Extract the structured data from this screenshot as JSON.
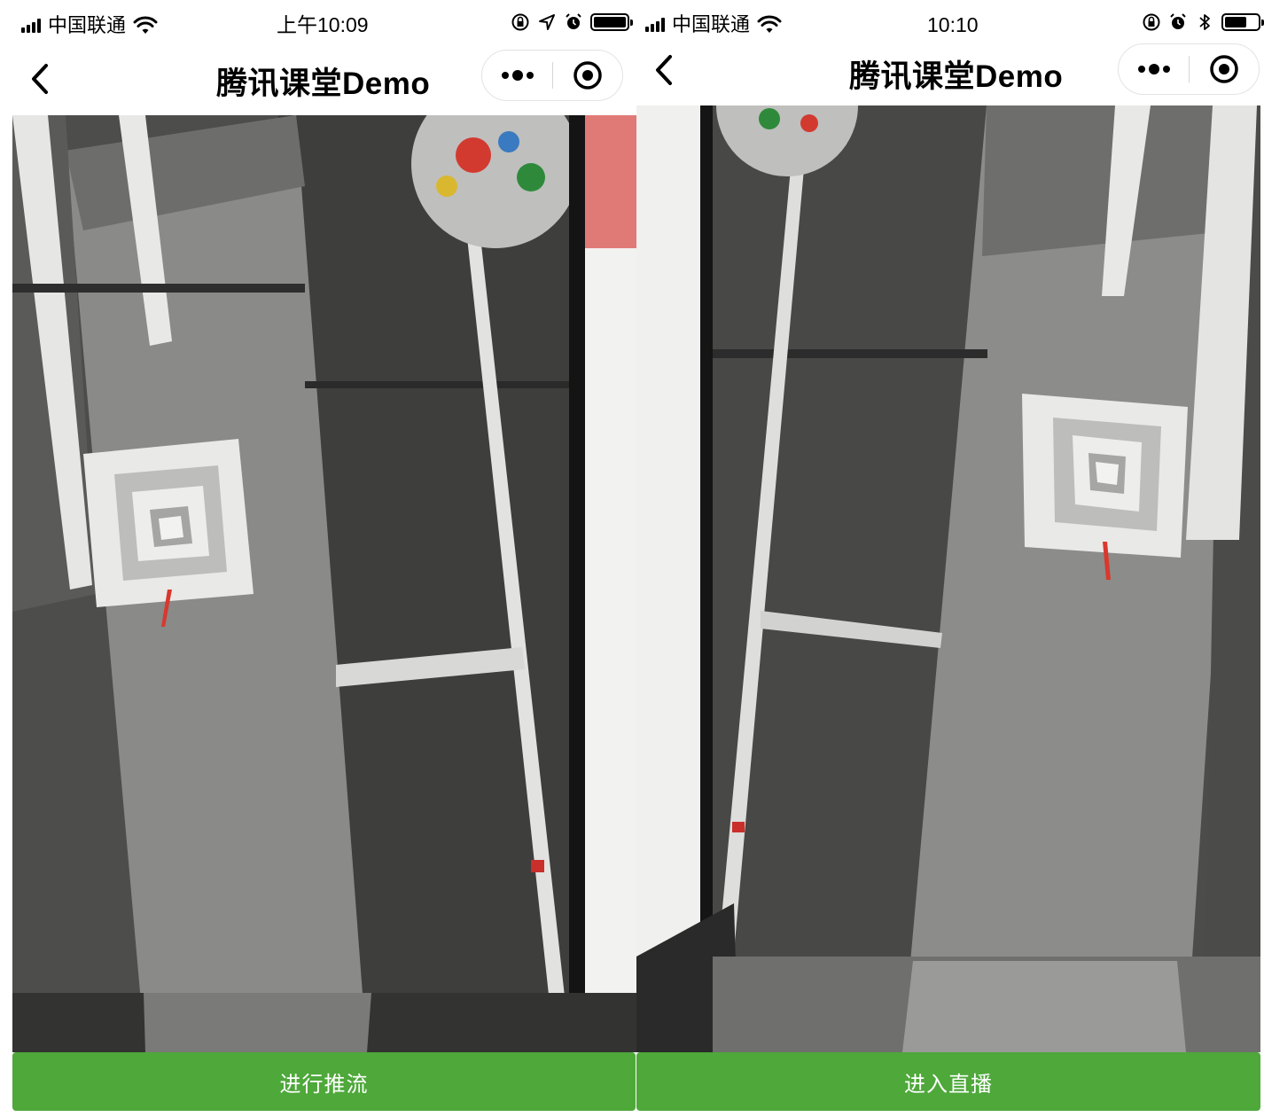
{
  "screens": [
    {
      "status_bar": {
        "carrier": "中国联通",
        "time": "上午10:09",
        "battery_level": 1.0
      },
      "nav": {
        "title": "腾讯课堂Demo"
      },
      "action_button": {
        "label": "进行推流"
      }
    },
    {
      "status_bar": {
        "carrier": "中国联通",
        "time": "10:10",
        "battery_level": 0.6
      },
      "nav": {
        "title": "腾讯课堂Demo"
      },
      "action_button": {
        "label": "进入直播"
      }
    }
  ],
  "colors": {
    "accent_green": "#4ea83a",
    "text": "#000000",
    "capsule_border": "#e3e3e3"
  },
  "icons": [
    "signal-icon",
    "wifi-icon",
    "orientation-lock-icon",
    "location-icon",
    "alarm-icon",
    "bluetooth-icon",
    "battery-icon",
    "back-icon",
    "more-icon",
    "close-miniprogram-icon"
  ]
}
